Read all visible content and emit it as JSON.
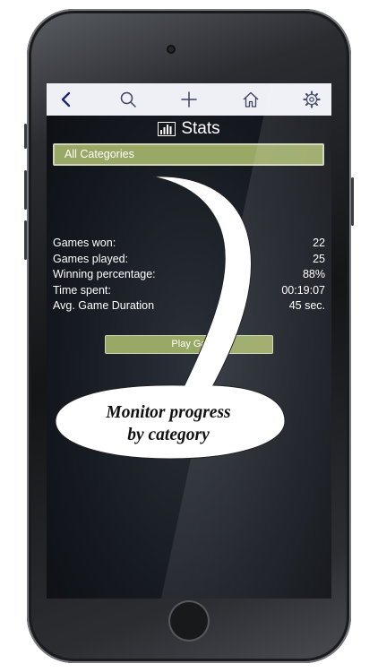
{
  "navbar": {
    "icons": [
      "back-arrow-icon",
      "search-icon",
      "plus-icon",
      "home-icon",
      "gear-icon"
    ]
  },
  "title": {
    "icon": "bar-chart-icon",
    "label": "Stats"
  },
  "category_selector": {
    "label": "All Categories"
  },
  "stats": [
    {
      "label": "Games won:",
      "value": "22"
    },
    {
      "label": "Games played:",
      "value": "25"
    },
    {
      "label": "Winning percentage:",
      "value": "88%"
    },
    {
      "label": "Time spent:",
      "value": "00:19:07"
    },
    {
      "label": "Avg. Game Duration",
      "value": "45 sec."
    }
  ],
  "play_button": {
    "label": "Play Ga"
  },
  "callout": {
    "line1": "Monitor progress",
    "line2": "by category"
  },
  "colors": {
    "accent_green": "#9aa865",
    "navbar_bg": "#eef0f5",
    "icon_blue": "#1f2a6b"
  }
}
